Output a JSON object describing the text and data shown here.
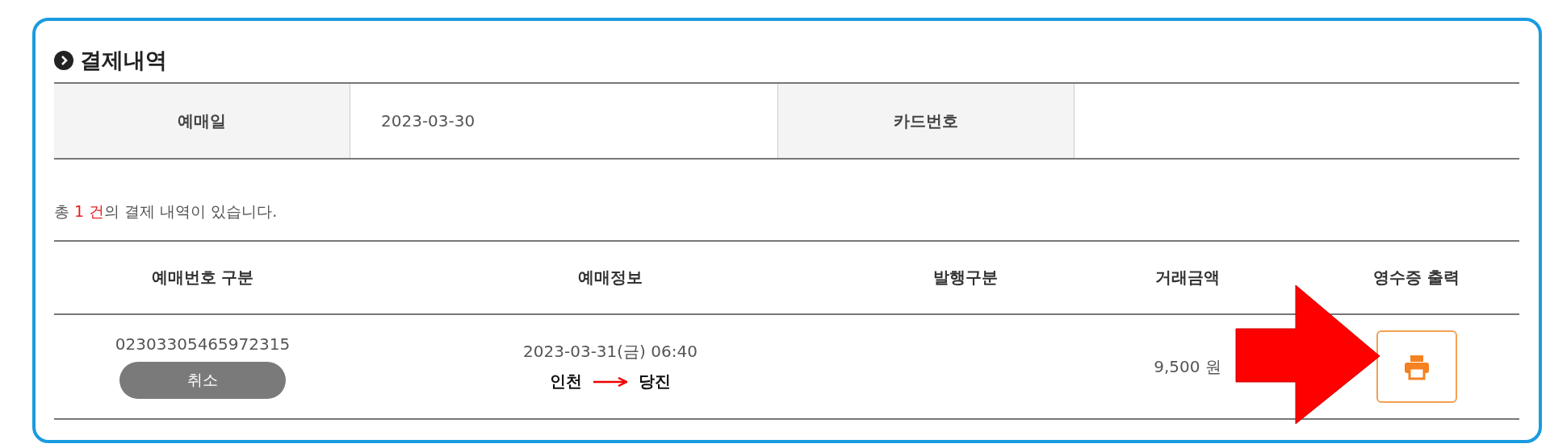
{
  "section_title": "결제내역",
  "info": [
    {
      "label": "예매일",
      "value": "2023-03-30"
    },
    {
      "label": "카드번호"
    }
  ],
  "summary": {
    "prefix": "총 ",
    "count": "1 건",
    "suffix": "의 결제 내역이 있습니다."
  },
  "table": {
    "columns": [
      "예매번호 구분",
      "예매정보",
      "발행구분",
      "거래금액",
      "영수증 출력"
    ],
    "rows": [
      {
        "booking_number": "02303305465972315",
        "cancel_button": "취소",
        "datetime": "2023-03-31(금) 06:40",
        "from": "인천",
        "to": "당진",
        "amount": "9,500 원"
      }
    ]
  }
}
